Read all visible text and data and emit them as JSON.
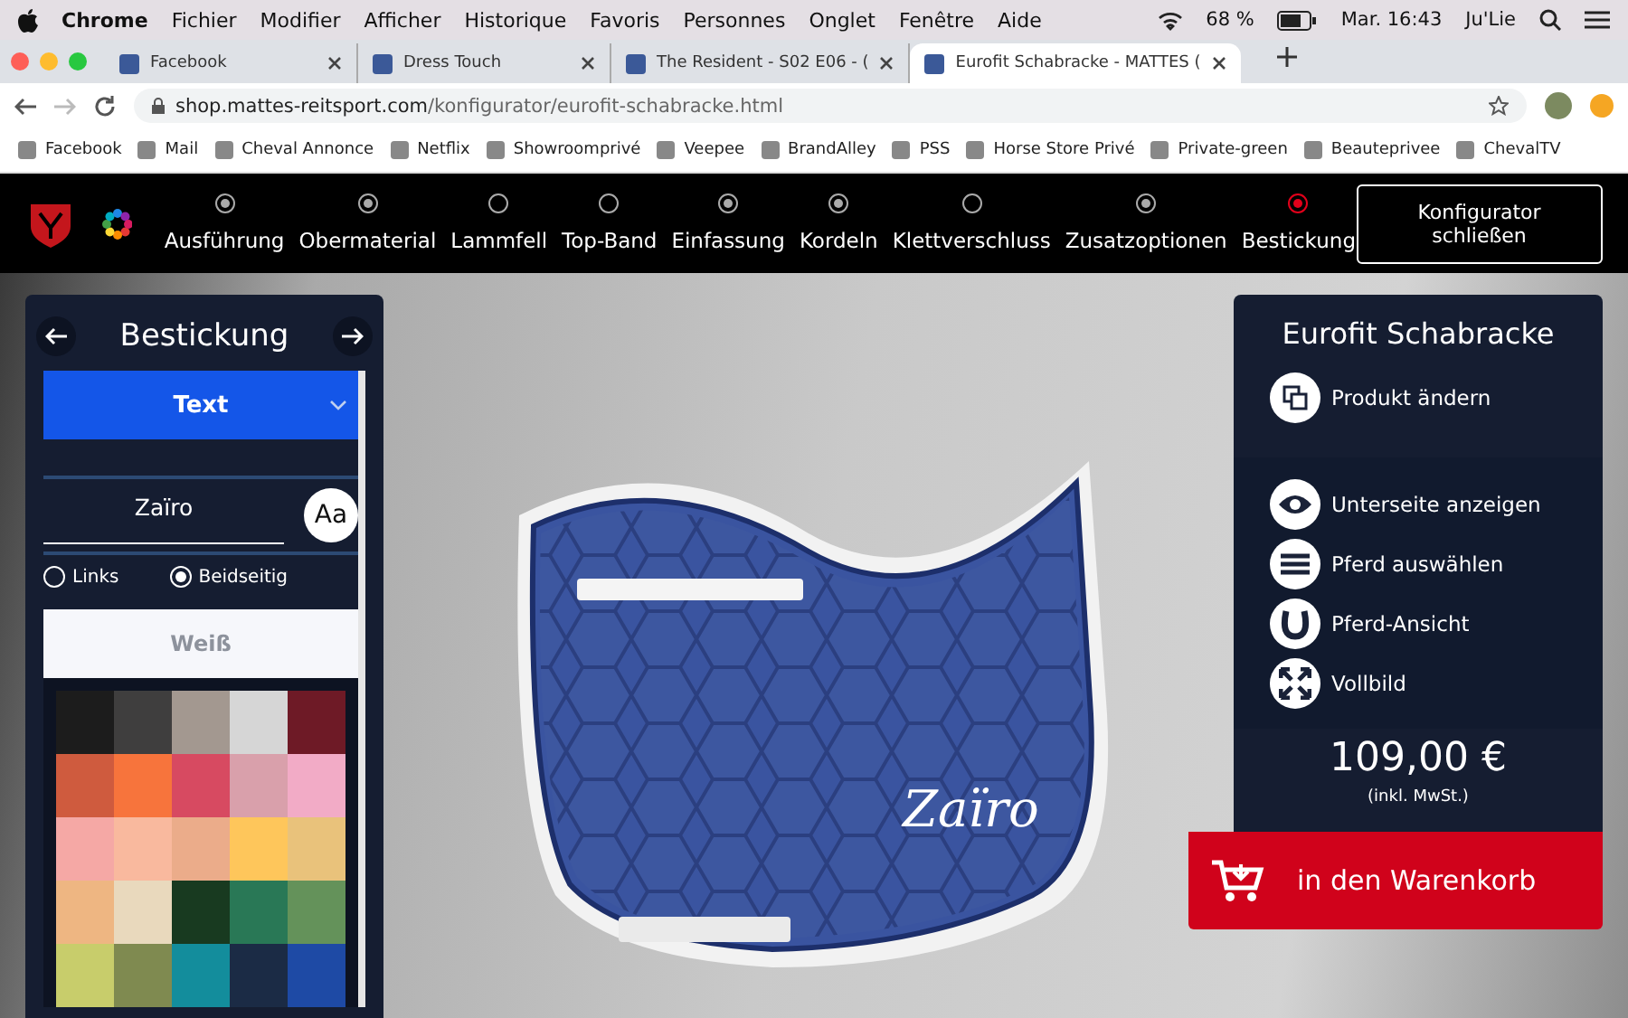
{
  "menu_bar": {
    "app": "Chrome",
    "items": [
      "Fichier",
      "Modifier",
      "Afficher",
      "Historique",
      "Favoris",
      "Personnes",
      "Onglet",
      "Fenêtre",
      "Aide"
    ],
    "battery": "68 %",
    "clock": "Mar. 16:43",
    "user": "Ju'Lie"
  },
  "tabs": [
    {
      "label": "Facebook",
      "selected": false
    },
    {
      "label": "Dress Touch",
      "selected": false
    },
    {
      "label": "The Resident - S02 E06 - (",
      "selected": false
    },
    {
      "label": "Eurofit Schabracke - MATTES (",
      "selected": true
    }
  ],
  "address": {
    "host": "shop.mattes-reitsport.com",
    "path": "/konfigurator/eurofit-schabracke.html"
  },
  "bookmarks": [
    "Facebook",
    "Mail",
    "Cheval Annonce",
    "Netflix",
    "Showroomprivé",
    "Veepee",
    "BrandAlley",
    "PSS",
    "Horse Store Privé",
    "Private-green",
    "Beauteprivee",
    "ChevalTV"
  ],
  "steps": [
    {
      "label": "Ausführung",
      "done": true,
      "selected": false
    },
    {
      "label": "Obermaterial",
      "done": true,
      "selected": false
    },
    {
      "label": "Lammfell",
      "done": false,
      "selected": false
    },
    {
      "label": "Top-Band",
      "done": false,
      "selected": false
    },
    {
      "label": "Einfassung",
      "done": true,
      "selected": false
    },
    {
      "label": "Kordeln",
      "done": true,
      "selected": false
    },
    {
      "label": "Klettverschluss",
      "done": false,
      "selected": false
    },
    {
      "label": "Zusatzoptionen",
      "done": true,
      "selected": false
    },
    {
      "label": "Bestickung",
      "done": false,
      "selected": true
    }
  ],
  "close_button": "Konfigurator schließen",
  "left_panel": {
    "title": "Bestickung",
    "dropdown": "Text",
    "text_value": "Zaïro",
    "font_button": "Aa",
    "placement": [
      {
        "label": "Links",
        "selected": false
      },
      {
        "label": "Beidseitig",
        "selected": true
      }
    ],
    "thread_color": "Weiß",
    "swatches": [
      {
        "color": "#1c1c1c"
      },
      {
        "color": "#3f3e3e"
      },
      {
        "color": "#a39890"
      },
      {
        "color": "#d6d6d6"
      },
      {
        "color": "#6e1a26"
      },
      {
        "color": "#cf5b3e"
      },
      {
        "color": "#f7743c"
      },
      {
        "color": "#d74a61"
      },
      {
        "color": "#d9a0ab"
      },
      {
        "color": "#f2abc6"
      },
      {
        "color": "#f5a8a5"
      },
      {
        "color": "#f9b99e"
      },
      {
        "color": "#ebac8a"
      },
      {
        "color": "#fec65b"
      },
      {
        "color": "#e9c27b"
      },
      {
        "color": "#eeb682"
      },
      {
        "color": "#e9d9bd"
      },
      {
        "color": "#183a20"
      },
      {
        "color": "#297856"
      },
      {
        "color": "#64925a"
      },
      {
        "color": "#c8cd6b"
      },
      {
        "color": "#7f8a50"
      },
      {
        "color": "#138d9c"
      },
      {
        "color": "#1b2b45"
      },
      {
        "color": "#1e4aa5"
      }
    ]
  },
  "preview": {
    "embroidery": "Zaïro"
  },
  "right_panel": {
    "title": "Eurofit Schabracke",
    "change_product": "Produkt ändern",
    "actions": [
      {
        "label": "Unterseite anzeigen",
        "kind": "eye"
      },
      {
        "label": "Pferd auswählen",
        "kind": "list"
      },
      {
        "label": "Pferd-Ansicht",
        "kind": "horseshoe"
      },
      {
        "label": "Vollbild",
        "kind": "fullscreen"
      }
    ],
    "price": "109,00 €",
    "tax_note": "(inkl. MwSt.)"
  },
  "cart_button": "in den Warenkorb"
}
